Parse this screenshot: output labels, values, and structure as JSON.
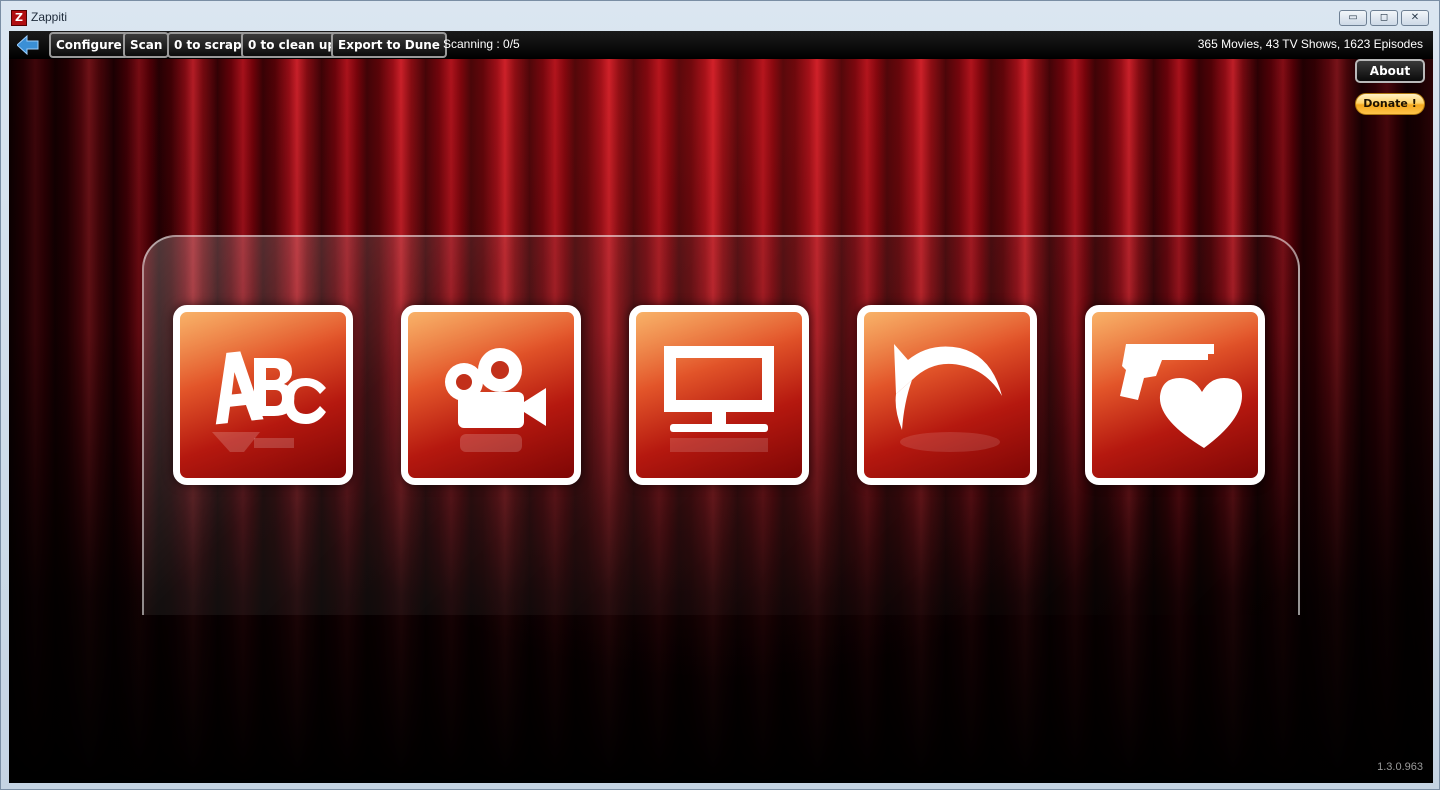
{
  "window": {
    "title": "Zappiti",
    "app_icon_letter": "Z",
    "controls": {
      "minimize": "▭",
      "maximize": "◻",
      "close": "✕"
    }
  },
  "toolbar": {
    "back_icon": "back-arrow-icon",
    "buttons": [
      {
        "id": "configure",
        "label": "Configure"
      },
      {
        "id": "scan",
        "label": "Scan"
      },
      {
        "id": "scrap",
        "label": "0 to scrap"
      },
      {
        "id": "cleanup",
        "label": "0 to clean up"
      },
      {
        "id": "export",
        "label": "Export to Dune"
      }
    ],
    "scan_status": "Scanning : 0/5",
    "library_count": "365 Movies, 43 TV Shows, 1623 Episodes"
  },
  "side": {
    "about_label": "About",
    "donate_label": "Donate !"
  },
  "tiles": [
    {
      "id": "abc",
      "icon": "abc-letters-icon"
    },
    {
      "id": "movies",
      "icon": "movie-camera-icon"
    },
    {
      "id": "tvshows",
      "icon": "tv-monitor-icon"
    },
    {
      "id": "recent",
      "icon": "curved-back-arrow-icon"
    },
    {
      "id": "genres",
      "icon": "gun-and-heart-icon"
    }
  ],
  "version": "1.3.0.963",
  "colors": {
    "curtain": "#a5101b",
    "tile_top": "#f7a24a",
    "tile_bottom": "#7e0605",
    "donate": "#f4a81d"
  }
}
